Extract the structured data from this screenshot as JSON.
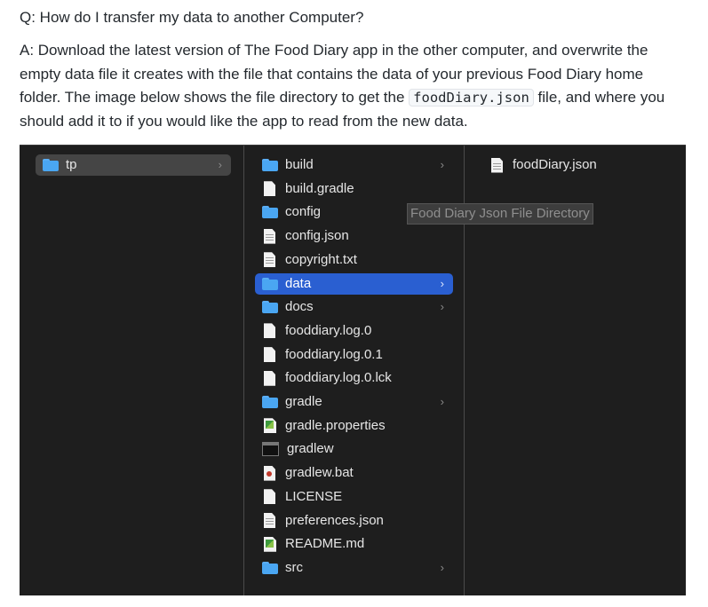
{
  "question": "Q: How do I transfer my data to another Computer?",
  "answer": {
    "part1": "A: Download the latest version of The Food Diary app in the other computer, and overwrite the empty data file it creates with the file that contains the data of your previous Food Diary home folder. The image below shows the file directory to get the ",
    "code": "foodDiary.json",
    "part2": " file, and where you should add it to if you would like the app to read from the new data."
  },
  "finder": {
    "column1": [
      {
        "name": "tp",
        "icon": "folder-icon",
        "chevron": true,
        "selected": "inactive"
      }
    ],
    "column2": [
      {
        "name": "build",
        "icon": "folder-icon",
        "chevron": true
      },
      {
        "name": "build.gradle",
        "icon": "file-icon",
        "chevron": false
      },
      {
        "name": "config",
        "icon": "folder-icon",
        "chevron": true
      },
      {
        "name": "config.json",
        "icon": "document-icon",
        "chevron": false
      },
      {
        "name": "copyright.txt",
        "icon": "document-icon",
        "chevron": false
      },
      {
        "name": "data",
        "icon": "folder-icon",
        "chevron": true,
        "selected": "active"
      },
      {
        "name": "docs",
        "icon": "folder-icon",
        "chevron": true
      },
      {
        "name": "fooddiary.log.0",
        "icon": "file-icon",
        "chevron": false
      },
      {
        "name": "fooddiary.log.0.1",
        "icon": "file-icon",
        "chevron": false
      },
      {
        "name": "fooddiary.log.0.lck",
        "icon": "file-icon",
        "chevron": false
      },
      {
        "name": "gradle",
        "icon": "folder-icon",
        "chevron": true
      },
      {
        "name": "gradle.properties",
        "icon": "properties-icon",
        "chevron": false
      },
      {
        "name": "gradlew",
        "icon": "terminal-icon",
        "chevron": false
      },
      {
        "name": "gradlew.bat",
        "icon": "batch-file-icon",
        "chevron": false
      },
      {
        "name": "LICENSE",
        "icon": "file-icon",
        "chevron": false
      },
      {
        "name": "preferences.json",
        "icon": "document-icon",
        "chevron": false
      },
      {
        "name": "README.md",
        "icon": "markdown-icon",
        "chevron": false
      },
      {
        "name": "src",
        "icon": "folder-icon",
        "chevron": true
      }
    ],
    "column3": [
      {
        "name": "foodDiary.json",
        "icon": "document-icon",
        "chevron": false
      }
    ],
    "chevron_glyph": "›",
    "tooltip": "Food Diary Json File Directory"
  },
  "colors": {
    "selection": "#2a5fd1",
    "folder": "#4aa6f2",
    "background": "#1e1e1e"
  }
}
